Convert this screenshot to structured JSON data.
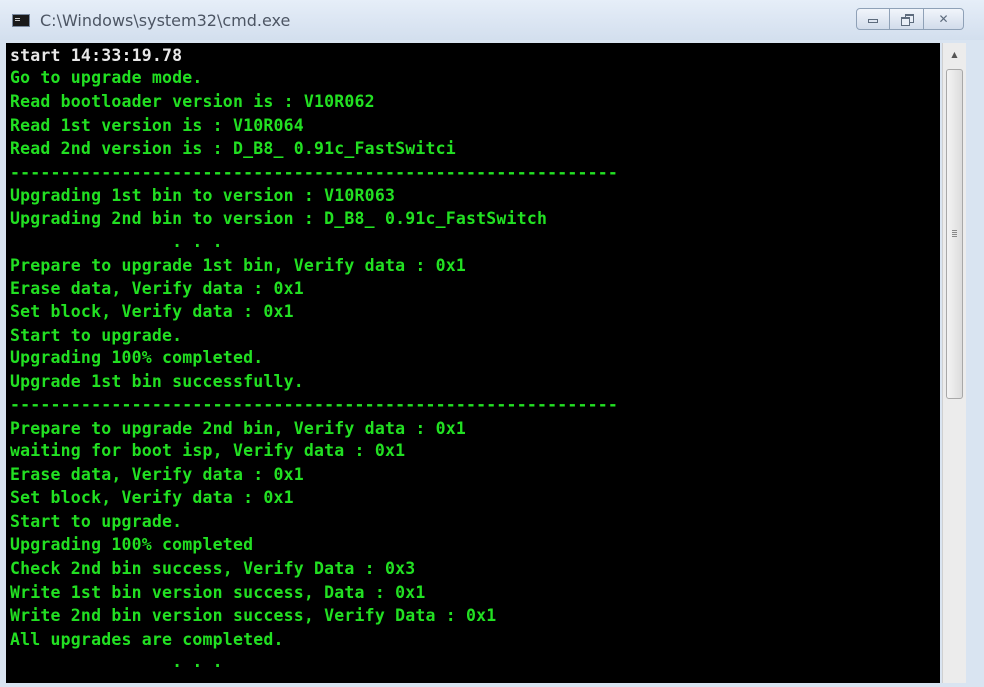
{
  "window": {
    "title": "C:\\Windows\\system32\\cmd.exe",
    "icon": "console-app-icon",
    "controls": [
      {
        "name": "minimize",
        "icon": "minimize-icon"
      },
      {
        "name": "maximize",
        "icon": "restore-icon"
      },
      {
        "name": "close",
        "icon": "close-icon",
        "glyph": "✕"
      }
    ]
  },
  "colors": {
    "console_bg": "#000000",
    "console_text_green": "#22e022",
    "console_text_white": "#e8e8e8",
    "titlebar": "#d9e4f1"
  },
  "console": {
    "lines": [
      {
        "text": "start 14:33:19.78",
        "color": "white"
      },
      {
        "text": "Go to upgrade mode.",
        "color": "green"
      },
      {
        "text": "Read bootloader version is : V10R062",
        "color": "green"
      },
      {
        "text": "Read 1st version is : V10R064",
        "color": "green"
      },
      {
        "text": "Read 2nd version is : D_B8_ 0.91c_FastSwitci",
        "color": "green"
      },
      {
        "text": "------------------------------------------------------------",
        "color": "green"
      },
      {
        "text": "Upgrading 1st bin to version : V10R063",
        "color": "green"
      },
      {
        "text": "Upgrading 2nd bin to version : D_B8_ 0.91c_FastSwitch",
        "color": "green"
      },
      {
        "text": "                . . .",
        "color": "green"
      },
      {
        "text": "Prepare to upgrade 1st bin, Verify data : 0x1",
        "color": "green"
      },
      {
        "text": "Erase data, Verify data : 0x1",
        "color": "green"
      },
      {
        "text": "Set block, Verify data : 0x1",
        "color": "green"
      },
      {
        "text": "Start to upgrade.",
        "color": "green"
      },
      {
        "text": "Upgrading 100% completed.",
        "color": "green"
      },
      {
        "text": "Upgrade 1st bin successfully.",
        "color": "green"
      },
      {
        "text": "------------------------------------------------------------",
        "color": "green"
      },
      {
        "text": "Prepare to upgrade 2nd bin, Verify data : 0x1",
        "color": "green"
      },
      {
        "text": "waiting for boot isp, Verify data : 0x1",
        "color": "green"
      },
      {
        "text": "Erase data, Verify data : 0x1",
        "color": "green"
      },
      {
        "text": "Set block, Verify data : 0x1",
        "color": "green"
      },
      {
        "text": "Start to upgrade.",
        "color": "green"
      },
      {
        "text": "Upgrading 100% completed",
        "color": "green"
      },
      {
        "text": "Check 2nd bin success, Verify Data : 0x3",
        "color": "green"
      },
      {
        "text": "Write 1st bin version success, Data : 0x1",
        "color": "green"
      },
      {
        "text": "Write 2nd bin version success, Verify Data : 0x1",
        "color": "green"
      },
      {
        "text": "All upgrades are completed.",
        "color": "green"
      },
      {
        "text": "                . . .",
        "color": "green"
      }
    ]
  },
  "scrollbar": {
    "up_arrow_icon": "scroll-up-arrow-icon",
    "position": 0.0
  }
}
